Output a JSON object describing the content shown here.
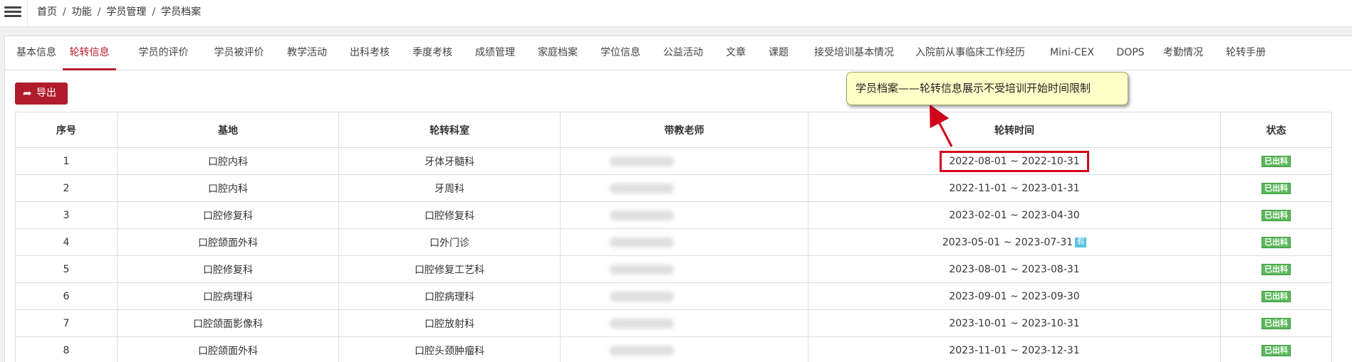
{
  "topbar": {
    "menu_icon": "hamburger-menu-icon",
    "breadcrumb": [
      "首页",
      "功能",
      "学员管理",
      "学员档案"
    ],
    "separator": "/"
  },
  "tabs": [
    {
      "label": "基本信息",
      "active": false
    },
    {
      "label": "轮转信息",
      "active": true
    },
    {
      "label": "学员的评价",
      "active": false
    },
    {
      "label": "学员被评价",
      "active": false
    },
    {
      "label": "教学活动",
      "active": false
    },
    {
      "label": "出科考核",
      "active": false
    },
    {
      "label": "季度考核",
      "active": false
    },
    {
      "label": "成绩管理",
      "active": false
    },
    {
      "label": "家庭档案",
      "active": false
    },
    {
      "label": "学位信息",
      "active": false
    },
    {
      "label": "公益活动",
      "active": false
    },
    {
      "label": "文章",
      "active": false
    },
    {
      "label": "课题",
      "active": false
    },
    {
      "label": "接受培训基本情况",
      "active": false
    },
    {
      "label": "入院前从事临床工作经历",
      "active": false
    },
    {
      "label": "Mini-CEX",
      "active": false
    },
    {
      "label": "DOPS",
      "active": false
    },
    {
      "label": "考勤情况",
      "active": false
    },
    {
      "label": "轮转手册",
      "active": false
    }
  ],
  "toolbar": {
    "export_label": "导出",
    "export_icon": "share-arrow-icon",
    "accent_color": "#b01c2b"
  },
  "table": {
    "headers": [
      "序号",
      "基地",
      "轮转科室",
      "带教老师",
      "轮转时间",
      "状态"
    ],
    "rows": [
      {
        "no": "1",
        "base": "口腔内科",
        "dept": "牙体牙髓科",
        "time": "2022-08-01 ~ 2022-10-31",
        "status": "已出科",
        "tag": ""
      },
      {
        "no": "2",
        "base": "口腔内科",
        "dept": "牙周科",
        "time": "2022-11-01 ~ 2023-01-31",
        "status": "已出科",
        "tag": ""
      },
      {
        "no": "3",
        "base": "口腔修复科",
        "dept": "口腔修复科",
        "time": "2023-02-01 ~ 2023-04-30",
        "status": "已出科",
        "tag": ""
      },
      {
        "no": "4",
        "base": "口腔颌面外科",
        "dept": "口外门诊",
        "time": "2023-05-01 ~ 2023-07-31",
        "status": "已出科",
        "tag": "假"
      },
      {
        "no": "5",
        "base": "口腔修复科",
        "dept": "口腔修复工艺科",
        "time": "2023-08-01 ~ 2023-08-31",
        "status": "已出科",
        "tag": ""
      },
      {
        "no": "6",
        "base": "口腔病理科",
        "dept": "口腔病理科",
        "time": "2023-09-01 ~ 2023-09-30",
        "status": "已出科",
        "tag": ""
      },
      {
        "no": "7",
        "base": "口腔颌面影像科",
        "dept": "口腔放射科",
        "time": "2023-10-01 ~ 2023-10-31",
        "status": "已出科",
        "tag": ""
      },
      {
        "no": "8",
        "base": "口腔颌面外科",
        "dept": "口腔头颈肿瘤科",
        "time": "2023-11-01 ~ 2023-12-31",
        "status": "已出科",
        "tag": ""
      }
    ]
  },
  "annotation": {
    "text": "学员档案——轮转信息展示不受培训开始时间限制",
    "highlight_color": "#d0021b"
  },
  "colors": {
    "active_tab": "#b7202e",
    "status_badge": "#5cb85c",
    "tag_badge": "#5bc0de"
  }
}
